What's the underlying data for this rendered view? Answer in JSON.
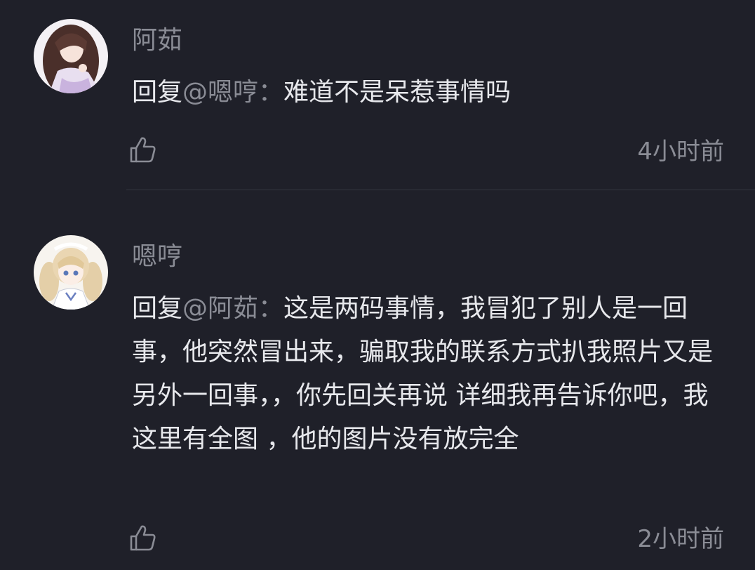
{
  "comments": [
    {
      "username": "阿茹",
      "reply_prefix": "回复",
      "mention": "@嗯哼：",
      "text": "难道不是呆惹事情吗",
      "timestamp": "4小时前",
      "avatar_icon": "avatar-brown-hair-girl"
    },
    {
      "username": "嗯哼",
      "reply_prefix": "回复",
      "mention": "@阿茹：",
      "text": "这是两码事情，我冒犯了别人是一回事，他突然冒出来，骗取我的联系方式扒我照片又是另外一回事，，你先回关再说 详细我再告诉你吧，我这里有全图 ，他的图片没有放完全",
      "timestamp": "2小时前",
      "avatar_icon": "avatar-blonde-twintail-girl"
    }
  ],
  "icons": {
    "like": "thumbs-up-icon"
  },
  "colors": {
    "background": "#1f2029",
    "primary_text": "#e7e8ec",
    "secondary_text": "#8a8c95",
    "divider": "#34363f"
  }
}
